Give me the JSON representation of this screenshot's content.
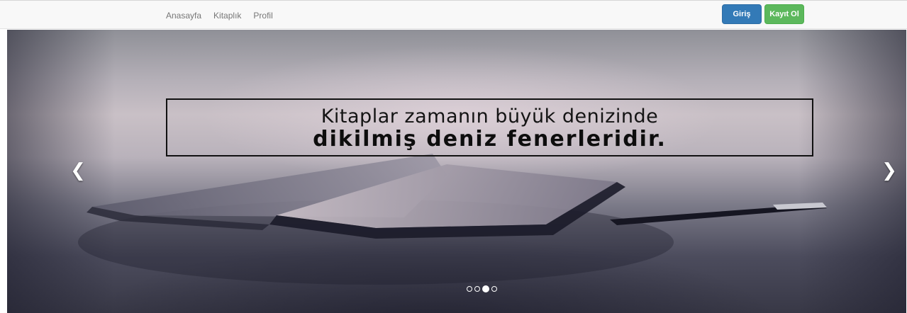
{
  "navbar": {
    "links": [
      "Anasayfa",
      "Kitaplık",
      "Profil"
    ],
    "login_label": "Giriş",
    "signup_label": "Kayıt Ol",
    "colors": {
      "login": "#337ab7",
      "signup": "#5cb85c"
    }
  },
  "carousel": {
    "quote_line1": "Kitaplar zamanın büyük denizinde",
    "quote_line2": "dikilmiş deniz fenerleridir.",
    "prev_icon": "chevron-left-icon",
    "next_icon": "chevron-right-icon",
    "prev_glyph": "❮",
    "next_glyph": "❯",
    "slide_count": 4,
    "active_slide": 3
  }
}
